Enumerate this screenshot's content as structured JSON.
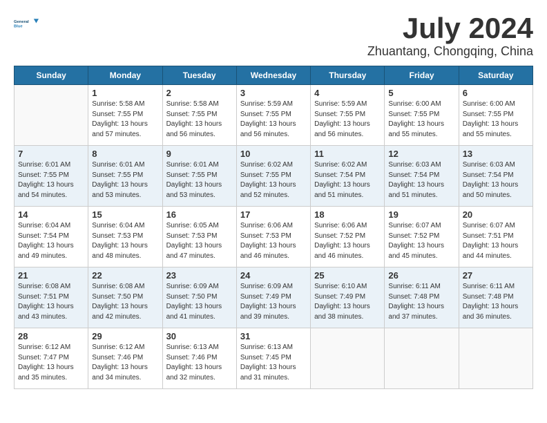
{
  "header": {
    "logo_line1": "General",
    "logo_line2": "Blue",
    "month": "July 2024",
    "location": "Zhuantang, Chongqing, China"
  },
  "weekdays": [
    "Sunday",
    "Monday",
    "Tuesday",
    "Wednesday",
    "Thursday",
    "Friday",
    "Saturday"
  ],
  "weeks": [
    [
      {
        "day": "",
        "info": ""
      },
      {
        "day": "1",
        "info": "Sunrise: 5:58 AM\nSunset: 7:55 PM\nDaylight: 13 hours\nand 57 minutes."
      },
      {
        "day": "2",
        "info": "Sunrise: 5:58 AM\nSunset: 7:55 PM\nDaylight: 13 hours\nand 56 minutes."
      },
      {
        "day": "3",
        "info": "Sunrise: 5:59 AM\nSunset: 7:55 PM\nDaylight: 13 hours\nand 56 minutes."
      },
      {
        "day": "4",
        "info": "Sunrise: 5:59 AM\nSunset: 7:55 PM\nDaylight: 13 hours\nand 56 minutes."
      },
      {
        "day": "5",
        "info": "Sunrise: 6:00 AM\nSunset: 7:55 PM\nDaylight: 13 hours\nand 55 minutes."
      },
      {
        "day": "6",
        "info": "Sunrise: 6:00 AM\nSunset: 7:55 PM\nDaylight: 13 hours\nand 55 minutes."
      }
    ],
    [
      {
        "day": "7",
        "info": "Sunrise: 6:01 AM\nSunset: 7:55 PM\nDaylight: 13 hours\nand 54 minutes."
      },
      {
        "day": "8",
        "info": "Sunrise: 6:01 AM\nSunset: 7:55 PM\nDaylight: 13 hours\nand 53 minutes."
      },
      {
        "day": "9",
        "info": "Sunrise: 6:01 AM\nSunset: 7:55 PM\nDaylight: 13 hours\nand 53 minutes."
      },
      {
        "day": "10",
        "info": "Sunrise: 6:02 AM\nSunset: 7:55 PM\nDaylight: 13 hours\nand 52 minutes."
      },
      {
        "day": "11",
        "info": "Sunrise: 6:02 AM\nSunset: 7:54 PM\nDaylight: 13 hours\nand 51 minutes."
      },
      {
        "day": "12",
        "info": "Sunrise: 6:03 AM\nSunset: 7:54 PM\nDaylight: 13 hours\nand 51 minutes."
      },
      {
        "day": "13",
        "info": "Sunrise: 6:03 AM\nSunset: 7:54 PM\nDaylight: 13 hours\nand 50 minutes."
      }
    ],
    [
      {
        "day": "14",
        "info": "Sunrise: 6:04 AM\nSunset: 7:54 PM\nDaylight: 13 hours\nand 49 minutes."
      },
      {
        "day": "15",
        "info": "Sunrise: 6:04 AM\nSunset: 7:53 PM\nDaylight: 13 hours\nand 48 minutes."
      },
      {
        "day": "16",
        "info": "Sunrise: 6:05 AM\nSunset: 7:53 PM\nDaylight: 13 hours\nand 47 minutes."
      },
      {
        "day": "17",
        "info": "Sunrise: 6:06 AM\nSunset: 7:53 PM\nDaylight: 13 hours\nand 46 minutes."
      },
      {
        "day": "18",
        "info": "Sunrise: 6:06 AM\nSunset: 7:52 PM\nDaylight: 13 hours\nand 46 minutes."
      },
      {
        "day": "19",
        "info": "Sunrise: 6:07 AM\nSunset: 7:52 PM\nDaylight: 13 hours\nand 45 minutes."
      },
      {
        "day": "20",
        "info": "Sunrise: 6:07 AM\nSunset: 7:51 PM\nDaylight: 13 hours\nand 44 minutes."
      }
    ],
    [
      {
        "day": "21",
        "info": "Sunrise: 6:08 AM\nSunset: 7:51 PM\nDaylight: 13 hours\nand 43 minutes."
      },
      {
        "day": "22",
        "info": "Sunrise: 6:08 AM\nSunset: 7:50 PM\nDaylight: 13 hours\nand 42 minutes."
      },
      {
        "day": "23",
        "info": "Sunrise: 6:09 AM\nSunset: 7:50 PM\nDaylight: 13 hours\nand 41 minutes."
      },
      {
        "day": "24",
        "info": "Sunrise: 6:09 AM\nSunset: 7:49 PM\nDaylight: 13 hours\nand 39 minutes."
      },
      {
        "day": "25",
        "info": "Sunrise: 6:10 AM\nSunset: 7:49 PM\nDaylight: 13 hours\nand 38 minutes."
      },
      {
        "day": "26",
        "info": "Sunrise: 6:11 AM\nSunset: 7:48 PM\nDaylight: 13 hours\nand 37 minutes."
      },
      {
        "day": "27",
        "info": "Sunrise: 6:11 AM\nSunset: 7:48 PM\nDaylight: 13 hours\nand 36 minutes."
      }
    ],
    [
      {
        "day": "28",
        "info": "Sunrise: 6:12 AM\nSunset: 7:47 PM\nDaylight: 13 hours\nand 35 minutes."
      },
      {
        "day": "29",
        "info": "Sunrise: 6:12 AM\nSunset: 7:46 PM\nDaylight: 13 hours\nand 34 minutes."
      },
      {
        "day": "30",
        "info": "Sunrise: 6:13 AM\nSunset: 7:46 PM\nDaylight: 13 hours\nand 32 minutes."
      },
      {
        "day": "31",
        "info": "Sunrise: 6:13 AM\nSunset: 7:45 PM\nDaylight: 13 hours\nand 31 minutes."
      },
      {
        "day": "",
        "info": ""
      },
      {
        "day": "",
        "info": ""
      },
      {
        "day": "",
        "info": ""
      }
    ]
  ]
}
